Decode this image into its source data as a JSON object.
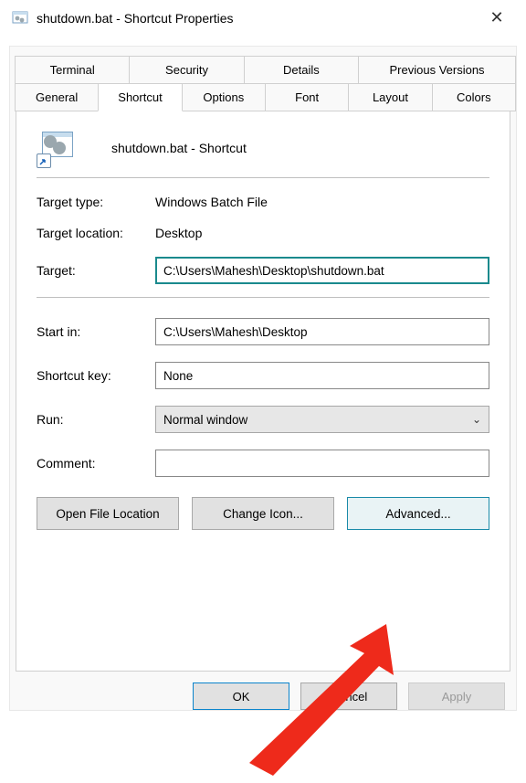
{
  "window": {
    "title": "shutdown.bat - Shortcut Properties"
  },
  "tabs": {
    "row1": [
      "Terminal",
      "Security",
      "Details",
      "Previous Versions"
    ],
    "row2": [
      "General",
      "Shortcut",
      "Options",
      "Font",
      "Layout",
      "Colors"
    ],
    "active": "Shortcut"
  },
  "shortcut": {
    "name": "shutdown.bat - Shortcut",
    "labels": {
      "target_type": "Target type:",
      "target_location": "Target location:",
      "target": "Target:",
      "start_in": "Start in:",
      "shortcut_key": "Shortcut key:",
      "run": "Run:",
      "comment": "Comment:"
    },
    "values": {
      "target_type": "Windows Batch File",
      "target_location": "Desktop",
      "target": "C:\\Users\\Mahesh\\Desktop\\shutdown.bat",
      "start_in": "C:\\Users\\Mahesh\\Desktop",
      "shortcut_key": "None",
      "run": "Normal window",
      "comment": ""
    },
    "buttons": {
      "open_location": "Open File Location",
      "change_icon": "Change Icon...",
      "advanced": "Advanced..."
    }
  },
  "footer": {
    "ok": "OK",
    "cancel": "Cancel",
    "apply": "Apply"
  }
}
